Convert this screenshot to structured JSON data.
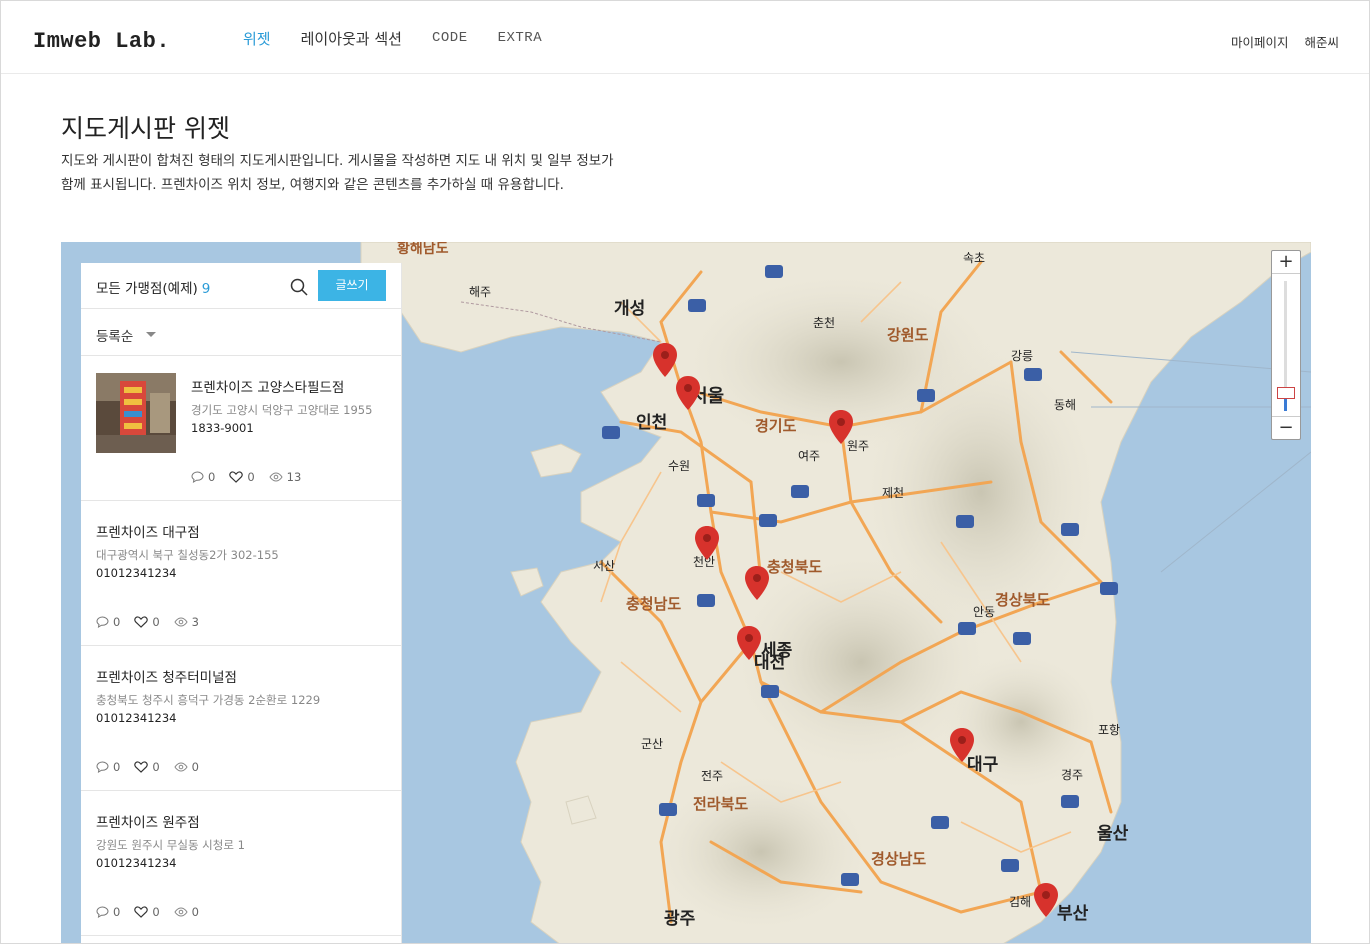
{
  "header": {
    "logo": "Imweb Lab.",
    "nav": [
      {
        "label": "위젯",
        "active": true
      },
      {
        "label": "레이아웃과 섹션"
      },
      {
        "label": "CODE"
      },
      {
        "label": "EXTRA"
      }
    ],
    "util": {
      "mypage": "마이페이지",
      "user": "해준씨"
    }
  },
  "intro": {
    "title": "지도게시판 위젯",
    "desc_line1": "지도와 게시판이 합쳐진 형태의 지도게시판입니다. 게시물을 작성하면 지도 내 위치 및 일부 정보가",
    "desc_line2": "함께 표시됩니다. 프렌차이즈 위치 정보, 여행지와 같은 콘텐츠를 추가하실 때 유용합니다."
  },
  "panel": {
    "title": "모든 가맹점(예제)",
    "count": "9",
    "write_label": "글쓰기",
    "sort_label": "등록순",
    "items": [
      {
        "name": "프렌차이즈 고양스타필드점",
        "address": "경기도 고양시 덕양구 고양대로 1955",
        "phone": "1833-9001",
        "comments": "0",
        "likes": "0",
        "views": "13"
      },
      {
        "name": "프렌차이즈 대구점",
        "address": "대구광역시 북구 칠성동2가 302-155",
        "phone": "01012341234",
        "comments": "0",
        "likes": "0",
        "views": "3"
      },
      {
        "name": "프렌차이즈 청주터미널점",
        "address": "충청북도 청주시 흥덕구 가경동 2순환로 1229",
        "phone": "01012341234",
        "comments": "0",
        "likes": "0",
        "views": "0"
      },
      {
        "name": "프렌차이즈 원주점",
        "address": "강원도 원주시 무실동 시청로 1",
        "phone": "01012341234",
        "comments": "0",
        "likes": "0",
        "views": "0"
      }
    ]
  },
  "map": {
    "labels": {
      "seoul": "서울",
      "incheon": "인천",
      "daejeon": "대전",
      "daegu": "대구",
      "busan": "부산",
      "gwangju": "광주",
      "ulsan": "울산",
      "gaeseong": "개성",
      "gangwon": "강원도",
      "gyeonggi": "경기도",
      "chungbuk": "충청북도",
      "chungnam": "충청남도",
      "gyeongbuk": "경상북도",
      "gyeongnam": "경상남도",
      "jeonbuk": "전라북도",
      "wonju": "원주",
      "cheonan": "천안",
      "sejong": "세종",
      "gangneung": "강릉",
      "pohang": "포항",
      "andong": "안동",
      "suwon": "수원",
      "chuncheon": "춘천",
      "donghae": "동해",
      "gunsan": "군산",
      "jeonju": "전주",
      "gimhae": "김해",
      "seosan": "서산",
      "gyeongju": "경주",
      "haeju": "해주",
      "yeoju": "여주",
      "jecheon": "제천",
      "hwanghae": "황해남도",
      "sokcho": "속초"
    }
  }
}
